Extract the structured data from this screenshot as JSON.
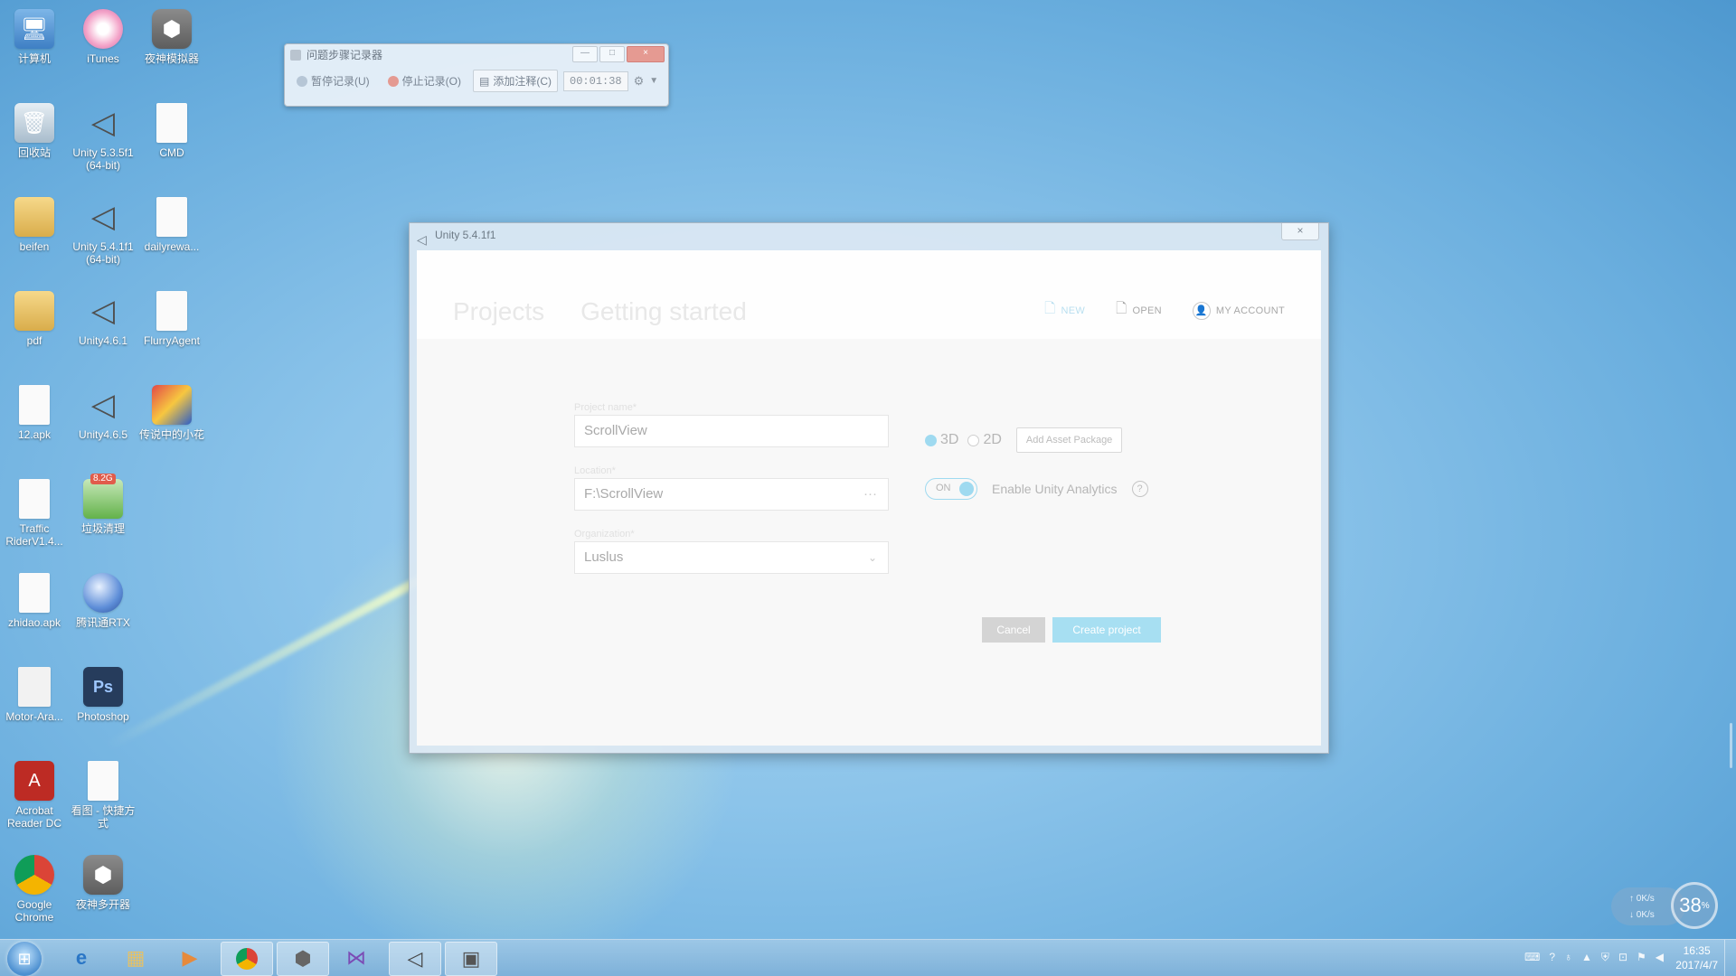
{
  "desktop": {
    "icons": [
      {
        "label": "计算机",
        "icon": "computer-icon"
      },
      {
        "label": "iTunes",
        "icon": "itunes-icon"
      },
      {
        "label": "夜神模拟器",
        "icon": "nox-icon"
      },
      {
        "label": "回收站",
        "icon": "recycle-bin-icon"
      },
      {
        "label": "Unity 5.3.5f1 (64-bit)",
        "icon": "unity-icon"
      },
      {
        "label": "CMD",
        "icon": "file-icon"
      },
      {
        "label": "beifen",
        "icon": "folder-icon"
      },
      {
        "label": "Unity 5.4.1f1 (64-bit)",
        "icon": "unity-icon"
      },
      {
        "label": "dailyrewa...",
        "icon": "file-icon"
      },
      {
        "label": "pdf",
        "icon": "folder-icon"
      },
      {
        "label": "Unity4.6.1",
        "icon": "unity-icon"
      },
      {
        "label": "FlurryAgent",
        "icon": "file-icon"
      },
      {
        "label": "12.apk",
        "icon": "file-icon"
      },
      {
        "label": "Unity4.6.5",
        "icon": "unity-icon"
      },
      {
        "label": "传说中的小花",
        "icon": "game-icon"
      },
      {
        "label": "Traffic RiderV1.4...",
        "icon": "file-icon"
      },
      {
        "label": "垃圾清理",
        "icon": "cleaner-icon"
      },
      {
        "label": "zhidao.apk",
        "icon": "file-icon"
      },
      {
        "label": "腾讯通RTX",
        "icon": "rtx-icon"
      },
      {
        "label": "Motor-Ara...",
        "icon": "document-icon"
      },
      {
        "label": "Photoshop",
        "icon": "photoshop-icon"
      },
      {
        "label": "Acrobat Reader DC",
        "icon": "acrobat-icon"
      },
      {
        "label": "看图 - 快捷方式",
        "icon": "shortcut-icon"
      },
      {
        "label": "Google Chrome",
        "icon": "chrome-icon"
      },
      {
        "label": "夜神多开器",
        "icon": "nox-icon"
      }
    ],
    "badge_cleaner": "8.2G"
  },
  "steps_recorder": {
    "title": "问题步骤记录器",
    "pause": "暂停记录(U)",
    "stop": "停止记录(O)",
    "add_comment": "添加注释(C)",
    "timer": "00:01:38",
    "min": "—",
    "max": "□",
    "close": "×"
  },
  "unity": {
    "title": "Unity 5.4.1f1",
    "close": "×",
    "tabs": [
      "Projects",
      "Getting started"
    ],
    "actions": {
      "new": "NEW",
      "open": "OPEN",
      "account": "MY ACCOUNT"
    },
    "form": {
      "project_name_label": "Project name*",
      "project_name": "ScrollView",
      "location_label": "Location*",
      "location": "F:\\ScrollView",
      "location_more": "···",
      "org_label": "Organization*",
      "org": "Luslus"
    },
    "options": {
      "mode_3d": "3D",
      "mode_2d": "2D",
      "selected_mode": "3D",
      "add_asset": "Add Asset Package",
      "toggle_label": "ON",
      "analytics": "Enable Unity Analytics",
      "help": "?"
    },
    "buttons": {
      "cancel": "Cancel",
      "create": "Create project"
    }
  },
  "network": {
    "up": "0K/s",
    "down": "0K/s",
    "percent": "38",
    "unit": "%"
  },
  "taskbar": {
    "time": "16:35",
    "date": "2017/4/7"
  }
}
